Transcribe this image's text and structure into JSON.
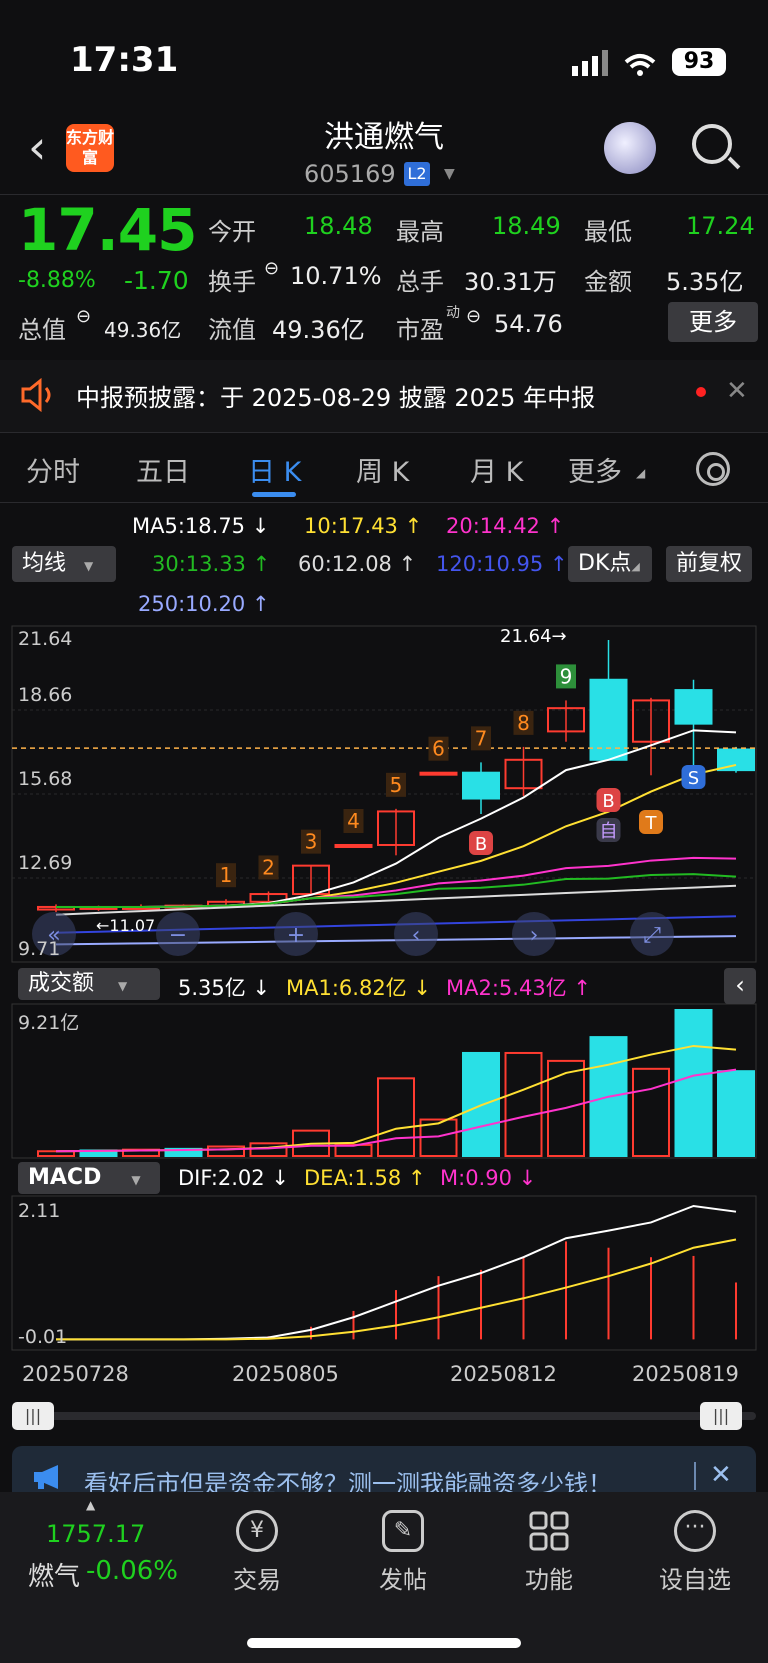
{
  "status_bar": {
    "time": "17:31",
    "battery": "93"
  },
  "header": {
    "title": "洪通燃气",
    "code": "605169",
    "level_badge": "L2",
    "logo_text": "东方财富"
  },
  "quote": {
    "price": "17.45",
    "change_pct": "-8.88%",
    "change": "-1.70",
    "open_label": "今开",
    "open": "18.48",
    "high_label": "最高",
    "high": "18.49",
    "low_label": "最低",
    "low": "17.24",
    "turnover_label": "换手",
    "turnover": "10.71%",
    "volume_label": "总手",
    "volume": "30.31万",
    "amount_label": "金额",
    "amount": "5.35亿",
    "mcap_label": "总值",
    "mcap": "49.36亿",
    "float_label": "流值",
    "float_cap": "49.36亿",
    "pe_label": "市盈",
    "pe_sup": "动",
    "pe": "54.76",
    "more_button": "更多"
  },
  "notice": {
    "text": "中报预披露：于 2025-08-29 披露 2025 年中报"
  },
  "tabs": [
    {
      "label": "分时"
    },
    {
      "label": "五日"
    },
    {
      "label": "日 K"
    },
    {
      "label": "周 K"
    },
    {
      "label": "月 K"
    },
    {
      "label": "更多"
    }
  ],
  "ma_panel": {
    "select": "均线",
    "ma5": "MA5:18.75",
    "ma10": "10:17.43",
    "ma20": "20:14.42",
    "ma30": "30:13.33",
    "ma60": "60:12.08",
    "ma120": "120:10.95",
    "ma250": "250:10.20",
    "dk_button": "DK点",
    "adjust_button": "前复权",
    "colors": {
      "ma5": "#ffffff",
      "ma10": "#ffe033",
      "ma20": "#ff33cc",
      "ma30": "#22bb22",
      "ma60": "#dddddd",
      "ma120": "#3344dd",
      "ma250": "#99aaff"
    }
  },
  "chart_data": {
    "type": "candlestick",
    "y_ticks": [
      "21.64",
      "18.66",
      "15.68",
      "12.69",
      "9.71"
    ],
    "ylim": [
      9.71,
      21.64
    ],
    "max_marker": "21.64→",
    "low_marker": "←11.07",
    "x_labels": [
      "20250728",
      "20250805",
      "20250812",
      "20250819"
    ],
    "candles": [
      {
        "o": 11.2,
        "c": 11.3,
        "h": 11.4,
        "l": 11.1
      },
      {
        "o": 11.25,
        "c": 11.3,
        "h": 11.35,
        "l": 11.15
      },
      {
        "o": 11.3,
        "c": 11.3,
        "h": 11.4,
        "l": 11.2
      },
      {
        "o": 11.3,
        "c": 11.35,
        "h": 11.4,
        "l": 11.2
      },
      {
        "o": 11.35,
        "c": 11.5,
        "h": 11.6,
        "l": 11.3
      },
      {
        "o": 11.5,
        "c": 11.8,
        "h": 11.9,
        "l": 11.4
      },
      {
        "o": 11.8,
        "c": 12.9,
        "h": 12.9,
        "l": 11.8
      },
      {
        "o": 13.7,
        "c": 13.7,
        "h": 13.7,
        "l": 13.7
      },
      {
        "o": 13.7,
        "c": 15.0,
        "h": 15.1,
        "l": 13.3
      },
      {
        "o": 16.5,
        "c": 16.5,
        "h": 16.5,
        "l": 16.5
      },
      {
        "o": 16.5,
        "c": 15.5,
        "h": 16.9,
        "l": 14.9
      },
      {
        "o": 15.9,
        "c": 17.0,
        "h": 17.5,
        "l": 15.6
      },
      {
        "o": 18.1,
        "c": 19.0,
        "h": 19.3,
        "l": 17.7
      },
      {
        "o": 20.1,
        "c": 17.0,
        "h": 21.64,
        "l": 17.0
      },
      {
        "o": 17.7,
        "c": 19.3,
        "h": 19.4,
        "l": 16.4
      },
      {
        "o": 19.7,
        "c": 18.4,
        "h": 20.1,
        "l": 16.3
      },
      {
        "o": 17.4,
        "c": 16.6,
        "h": 17.5,
        "l": 16.5
      }
    ],
    "number_marks": [
      "1",
      "2",
      "3",
      "4",
      "5",
      "6",
      "7",
      "8",
      "9"
    ],
    "signal_marks": [
      "B",
      "B",
      "自",
      "T",
      "S"
    ],
    "volume": {
      "select": "成交额",
      "current": "5.35亿",
      "ma1": "MA1:6.82亿",
      "ma2": "MA2:5.43亿",
      "max_label": "9.21亿",
      "max": 9.21,
      "values": [
        0.3,
        0.35,
        0.4,
        0.45,
        0.6,
        0.8,
        1.6,
        0.7,
        4.9,
        2.3,
        6.5,
        6.5,
        6.0,
        7.5,
        5.5,
        9.21,
        5.35
      ],
      "up": [
        false,
        true,
        false,
        true,
        false,
        false,
        false,
        false,
        false,
        false,
        true,
        false,
        false,
        true,
        false,
        true,
        true
      ]
    },
    "macd": {
      "select": "MACD",
      "dif": "DIF:2.02",
      "dea": "DEA:1.58",
      "m": "M:0.90",
      "max_label": "2.11",
      "min_label": "-0.01",
      "dif_values": [
        0.0,
        0.0,
        0.0,
        0.0,
        0.01,
        0.03,
        0.15,
        0.35,
        0.6,
        0.85,
        1.05,
        1.3,
        1.6,
        1.72,
        1.85,
        2.11,
        2.02
      ],
      "dea_values": [
        0.0,
        0.0,
        0.0,
        0.0,
        0.0,
        0.01,
        0.05,
        0.12,
        0.22,
        0.35,
        0.5,
        0.65,
        0.82,
        1.0,
        1.2,
        1.45,
        1.58
      ],
      "bars": [
        0.0,
        0.0,
        0.0,
        0.0,
        0.02,
        0.05,
        0.2,
        0.45,
        0.78,
        1.0,
        1.1,
        1.3,
        1.55,
        1.45,
        1.3,
        1.32,
        0.9
      ]
    }
  },
  "ad": {
    "text": "看好后市但是资金不够？测一测我能融资多少钱！"
  },
  "bottom_bar": {
    "index_value": "1757.17",
    "index_name": "燃气",
    "index_change": "-0.06%",
    "items": [
      {
        "label": "交易"
      },
      {
        "label": "发帖"
      },
      {
        "label": "功能"
      },
      {
        "label": "设自选"
      }
    ]
  }
}
